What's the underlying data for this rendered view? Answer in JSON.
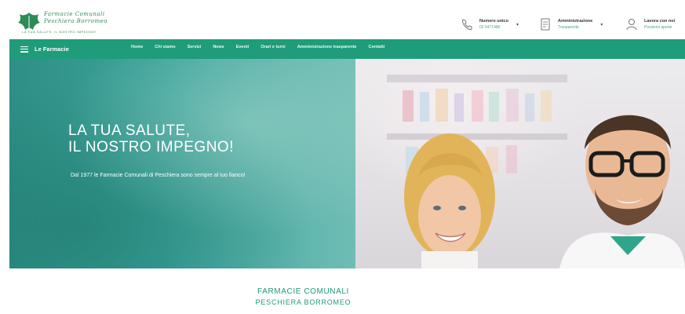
{
  "header": {
    "logo": {
      "line1": "Farmacie Comunali",
      "line2": "Peschiera Borromeo",
      "tagline": "La tua salute, il nostro impegno!",
      "icon": "leaf-logo-icon"
    },
    "phone": {
      "title": "Numero unico",
      "value": "02 5471486",
      "icon": "phone-icon"
    },
    "admin": {
      "title": "Amministrazione",
      "value": "Trasparente",
      "icon": "document-icon"
    },
    "jobs": {
      "title": "Lavora con noi",
      "value": "Posizioni aperte",
      "icon": "user-icon"
    }
  },
  "nav": {
    "brand": "Le Farmacie",
    "links": [
      "Home",
      "Chi siamo",
      "Servizi",
      "News",
      "Eventi",
      "Orari e turni",
      "Amministrazione trasparente",
      "Contatti"
    ]
  },
  "hero": {
    "title_line1": "LA TUA SALUTE,",
    "title_line2": "IL NOSTRO IMPEGNO!",
    "subtitle": "Dal 1977 le Farmacie Comunali di Peschiera sono sempre al tuo fianco!"
  },
  "intro": {
    "title": "FARMACIE COMUNALI",
    "subtitle": "PESCHIERA BORROMEO"
  },
  "colors": {
    "accent": "#1f9c79",
    "hero_teal": "#3ba39a",
    "link_green": "#4aa77a"
  }
}
